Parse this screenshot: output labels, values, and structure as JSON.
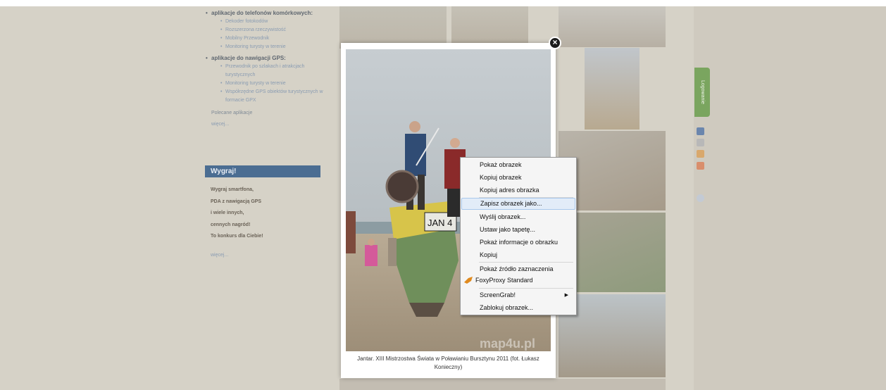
{
  "sidebar": {
    "groups": [
      {
        "title": "aplikacje do telefonów komórkowych:",
        "items": [
          "Dekoder fotokodów",
          "Rozszerzona rzeczywistość",
          "Mobilny Przewodnik",
          "Monitoring turysty w terenie"
        ]
      },
      {
        "title": "aplikacje do nawigacji GPS:",
        "items": [
          "Przewodnik po szlakach i atrakcjach turystycznych",
          "Monitoring turysty w terenie",
          "Współrzędne GPS obiektów turystycznych w formacie GPX"
        ]
      }
    ],
    "recommended": "Polecane aplikacje",
    "more1": "więcej...",
    "wygraj_title": "Wygraj!",
    "promo_lines": [
      "Wygraj smartfona,",
      "PDA z nawigacją GPS",
      "i wiele innych,",
      "cennych nagród!",
      "To konkurs dla Ciebie!"
    ],
    "more2": "więcej..."
  },
  "side": {
    "login_tab": "Logowanie"
  },
  "lightbox": {
    "caption": "Jantar. XIII Mistrzostwa Świata w Poławianiu Bursztynu 2011 (fot. Łukasz Konieczny)",
    "watermark": "map4u.pl",
    "boat_text": "JAN 4"
  },
  "context_menu": {
    "items": [
      {
        "label": "Pokaż obrazek",
        "highlight": false
      },
      {
        "label": "Kopiuj obrazek",
        "highlight": false
      },
      {
        "label": "Kopiuj adres obrazka",
        "highlight": false
      },
      {
        "label": "Zapisz obrazek jako...",
        "highlight": true
      },
      {
        "label": "Wyślij obrazek...",
        "highlight": false
      },
      {
        "label": "Ustaw jako tapetę...",
        "highlight": false
      },
      {
        "label": "Pokaż informacje o obrazku",
        "highlight": false
      },
      {
        "label": "Kopiuj",
        "highlight": false
      },
      {
        "label": "Pokaż źródło zaznaczenia",
        "highlight": false
      },
      {
        "label": "FoxyProxy Standard",
        "highlight": false
      },
      {
        "label": "ScreenGrab!",
        "highlight": false
      },
      {
        "label": "Zablokuj obrazek...",
        "highlight": false
      }
    ],
    "submenu_arrow": "▶"
  },
  "colors": {
    "accent": "#4b6d92",
    "login_green": "#7aa55f",
    "highlight": "#e2ecf8"
  },
  "icons": {
    "close": "close-icon",
    "foxyproxy": "fox-icon",
    "submenu": "chevron-right-icon"
  }
}
